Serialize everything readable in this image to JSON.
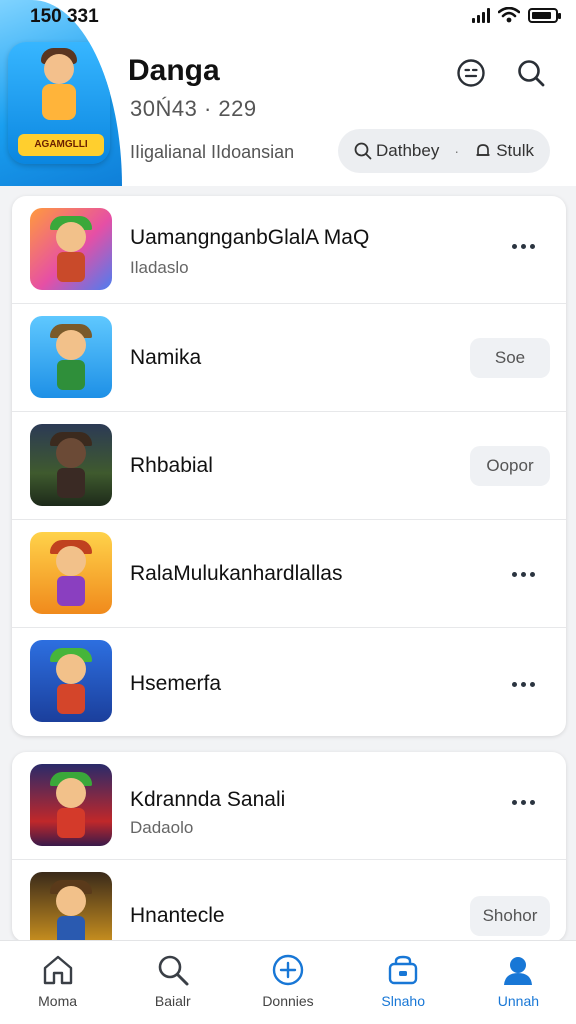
{
  "status_bar": {
    "time": "150 331"
  },
  "header": {
    "title": "Danga",
    "stats": "30Ń43 · 229",
    "subtitle": "IIigalianal IIdoansian",
    "logo_badge": "AGAMGLLI",
    "pill": {
      "item1": "Dathbey",
      "item2": "Stulk"
    }
  },
  "list": {
    "group1": [
      {
        "title": "UamangnganbGlalA MaQ",
        "subtitle": "Iladaslo",
        "action": "more"
      },
      {
        "title": "Namika",
        "action_label": "Soe"
      },
      {
        "title": "Rhbabial",
        "action_label": "Oopor"
      },
      {
        "title": "RalaMulukanhardlallas",
        "action": "more"
      },
      {
        "title": "Hsemerfa",
        "action": "more"
      }
    ],
    "group2": [
      {
        "title": "Kdrannda Sanali",
        "subtitle": "Dadaolo",
        "action": "more"
      },
      {
        "title": "Hnantecle",
        "action_label": "Shohor"
      }
    ]
  },
  "nav": [
    {
      "label": "Moma",
      "icon": "home-icon"
    },
    {
      "label": "Baialr",
      "icon": "search-icon"
    },
    {
      "label": "Donnies",
      "icon": "plus-circle-icon"
    },
    {
      "label": "Slnaho",
      "icon": "store-icon"
    },
    {
      "label": "Unnah",
      "icon": "profile-icon",
      "active": true
    }
  ],
  "colors": {
    "accent": "#1877d6",
    "header_art": "#1a9ff0"
  }
}
